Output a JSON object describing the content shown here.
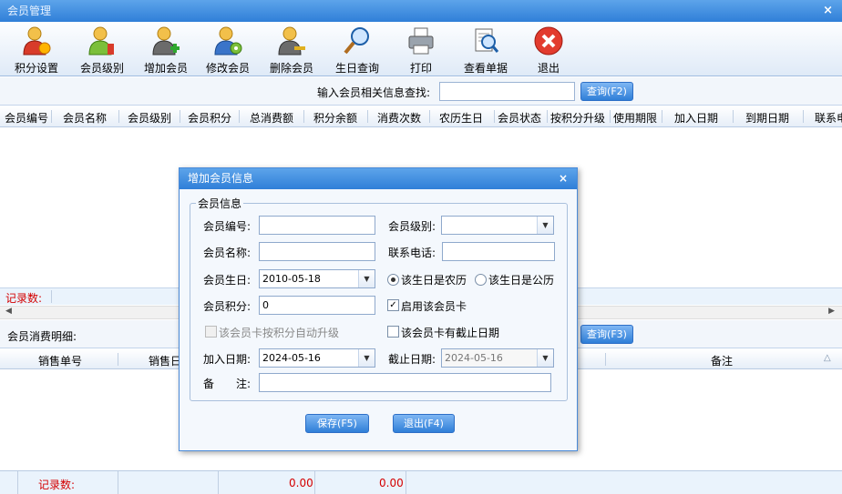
{
  "window": {
    "title": "会员管理",
    "close": "×"
  },
  "toolbar": [
    {
      "label": "积分设置",
      "icon": "points-settings-icon"
    },
    {
      "label": "会员级别",
      "icon": "member-level-icon"
    },
    {
      "label": "增加会员",
      "icon": "add-member-icon"
    },
    {
      "label": "修改会员",
      "icon": "edit-member-icon"
    },
    {
      "label": "删除会员",
      "icon": "delete-member-icon"
    },
    {
      "label": "生日查询",
      "icon": "magnifier-icon"
    },
    {
      "label": "打印",
      "icon": "printer-icon"
    },
    {
      "label": "查看单据",
      "icon": "view-receipt-icon"
    },
    {
      "label": "退出",
      "icon": "exit-icon"
    }
  ],
  "search": {
    "label": "输入会员相关信息查找:",
    "value": "",
    "button": "查询(F2)"
  },
  "member_columns": [
    "会员编号",
    "会员名称",
    "会员级别",
    "会员积分",
    "总消费额",
    "积分余额",
    "消费次数",
    "农历生日",
    "会员状态",
    "按积分升级",
    "使用期限",
    "加入日期",
    "到期日期",
    "联系电"
  ],
  "member_records": {
    "label": "记录数:",
    "value": ""
  },
  "detail": {
    "label": "会员消费明细:",
    "button": "查询(F3)"
  },
  "detail_columns": [
    "销售单号",
    "销售日",
    "备注"
  ],
  "footer": {
    "label": "记录数:",
    "amount1": "0.00",
    "amount2": "0.00"
  },
  "dialog": {
    "title": "增加会员信息",
    "close": "×",
    "group": "会员信息",
    "fields": {
      "member_no": {
        "label": "会员编号:",
        "value": ""
      },
      "level": {
        "label": "会员级别:",
        "value": ""
      },
      "name": {
        "label": "会员名称:",
        "value": ""
      },
      "phone": {
        "label": "联系电话:",
        "value": ""
      },
      "birthday": {
        "label": "会员生日:",
        "value": "2010-05-18"
      },
      "lunar": {
        "label": "该生日是农历",
        "checked": true
      },
      "solar": {
        "label": "该生日是公历",
        "checked": false
      },
      "points": {
        "label": "会员积分:",
        "value": "0"
      },
      "enable": {
        "label": "启用该会员卡",
        "checked": true
      },
      "auto_upgrade": {
        "label": "该会员卡按积分自动升级",
        "checked": false
      },
      "has_expiry": {
        "label": "该会员卡有截止日期",
        "checked": false
      },
      "join_date": {
        "label": "加入日期:",
        "value": "2024-05-16"
      },
      "end_date": {
        "label": "截止日期:",
        "value": "2024-05-16"
      },
      "remark": {
        "label": "备　　注:",
        "value": ""
      }
    },
    "save": "保存(F5)",
    "exit": "退出(F4)"
  }
}
